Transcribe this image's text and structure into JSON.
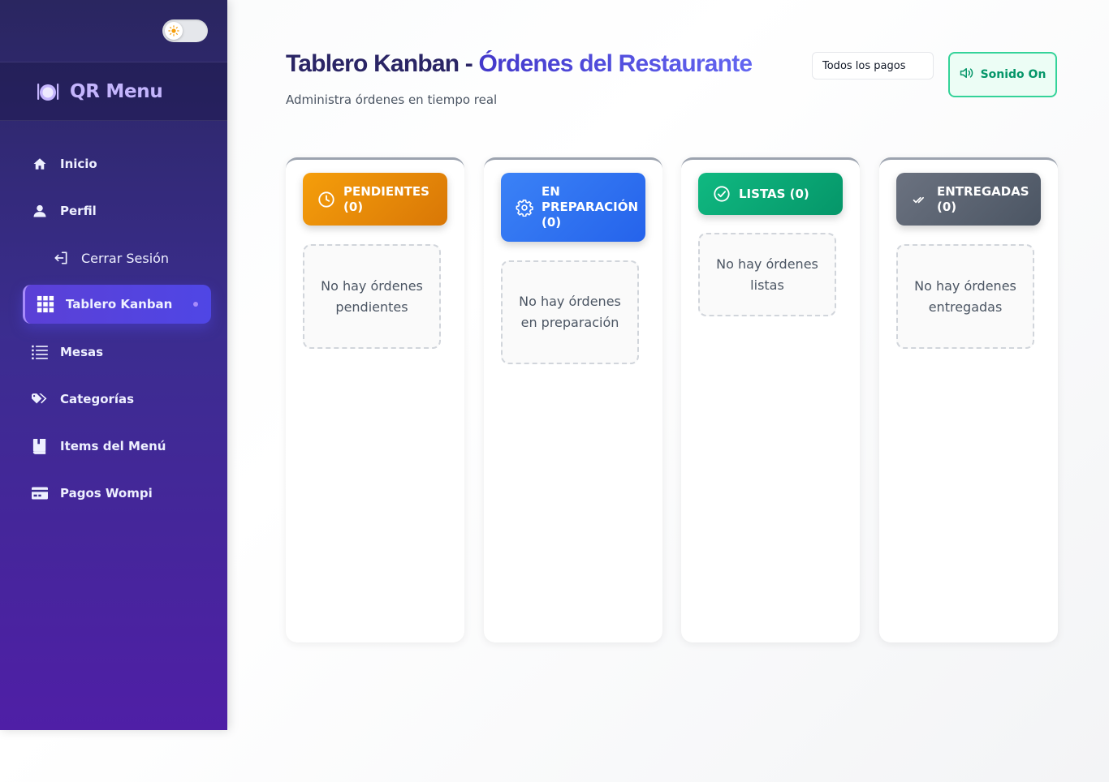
{
  "sidebar": {
    "brand": "QR Menu",
    "items": [
      {
        "label": "Inicio",
        "icon": "home-icon"
      },
      {
        "label": "Perfil",
        "icon": "user-icon"
      },
      {
        "label": "Cerrar Sesión",
        "icon": "logout-icon"
      },
      {
        "label": "Tablero Kanban",
        "icon": "grid-icon",
        "active": true
      },
      {
        "label": "Mesas",
        "icon": "list-icon"
      },
      {
        "label": "Categorías",
        "icon": "tags-icon"
      },
      {
        "label": "Items del Menú",
        "icon": "book-icon"
      },
      {
        "label": "Pagos Wompi",
        "icon": "credit-card-icon"
      }
    ]
  },
  "header": {
    "title_part1": "Tablero Kanban - ",
    "title_part2": "Órdenes del Restaurante",
    "subtitle": "Administra órdenes en tiempo real",
    "payments_filter": "Todos los pagos",
    "sound_label": "Sonido On"
  },
  "columns": [
    {
      "line1": "PENDIENTES",
      "line2": "(0)",
      "empty": "No hay órdenes pendientes",
      "color": "#f59e0b"
    },
    {
      "line1": "EN",
      "line2": "PREPARACIÓN",
      "line3": "(0)",
      "empty": "No hay órdenes en preparación",
      "color": "#3b82f6"
    },
    {
      "line1": "LISTAS (0)",
      "empty": "No hay órdenes listas",
      "color": "#10b981"
    },
    {
      "line1": "ENTREGADAS",
      "line2": "(0)",
      "empty": "No hay órdenes entregadas",
      "color": "#6b7280"
    }
  ],
  "colors": {
    "sidebar_top": "#2a2660",
    "sidebar_bottom": "#4f1fa6",
    "accent": "#4f46e5",
    "sound_green": "#059669"
  }
}
